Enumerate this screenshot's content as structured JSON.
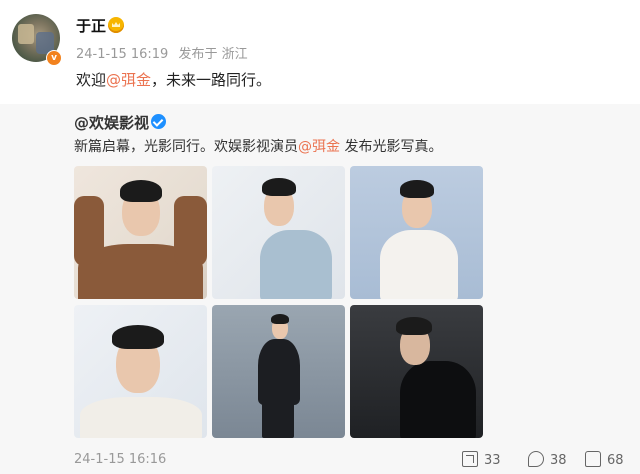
{
  "post": {
    "author": "于正",
    "timestamp": "24-1-15 16:19",
    "location": "发布于 浙江",
    "text_prefix": "欢迎",
    "mention": "@弭金",
    "text_suffix": "，未来一路同行。"
  },
  "repost": {
    "author": "@欢娱影视",
    "text_prefix": "新篇启幕，光影同行。欢娱影视演员",
    "mention": "@弭金",
    "text_suffix": " 发布光影写真。",
    "photo_count": 6,
    "timestamp": "24-1-15 16:16",
    "actions": {
      "share_count": "33",
      "comment_count": "38",
      "like_count": "68"
    }
  },
  "colors": {
    "mention": "#eb7350",
    "verified": "#1e90ff",
    "vip_badge": "#f7b500",
    "repost_bg": "#f7f7f7"
  },
  "icons": [
    "avatar",
    "vip-crown-icon",
    "verified-icon",
    "share-icon",
    "comment-icon",
    "like-icon"
  ]
}
